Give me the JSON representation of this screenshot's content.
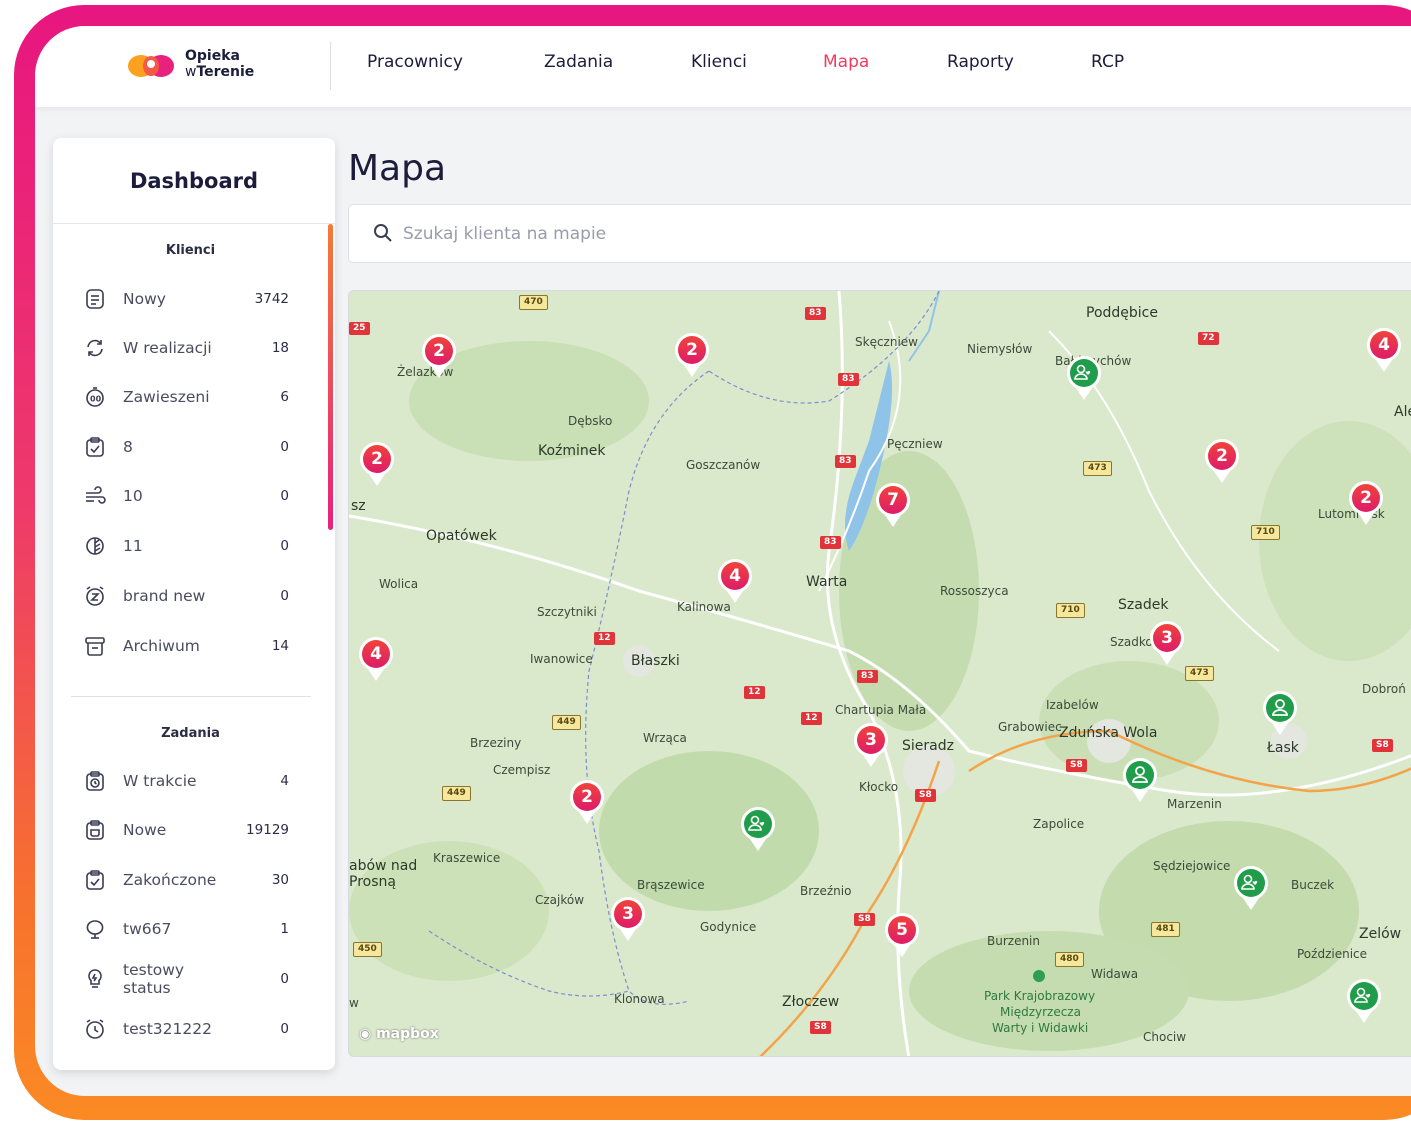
{
  "logo": {
    "line1": "Opieka",
    "line2a": "w",
    "line2b": "Terenie"
  },
  "nav": [
    {
      "label": "Pracownicy",
      "active": false
    },
    {
      "label": "Zadania",
      "active": false
    },
    {
      "label": "Klienci",
      "active": false
    },
    {
      "label": "Mapa",
      "active": true
    },
    {
      "label": "Raporty",
      "active": false
    },
    {
      "label": "RCP",
      "active": false
    }
  ],
  "sidebar": {
    "title": "Dashboard",
    "clients_section": "Klienci",
    "clients": [
      {
        "label": "Nowy",
        "count": "3742",
        "icon": "document-icon"
      },
      {
        "label": "W realizacji",
        "count": "18",
        "icon": "refresh-icon"
      },
      {
        "label": "Zawieszeni",
        "count": "6",
        "icon": "pause-timer-icon"
      },
      {
        "label": "8",
        "count": "0",
        "icon": "clipboard-check-icon"
      },
      {
        "label": "10",
        "count": "0",
        "icon": "wind-icon"
      },
      {
        "label": "11",
        "count": "0",
        "icon": "leaf-icon"
      },
      {
        "label": "brand new",
        "count": "0",
        "icon": "alarm-z-icon"
      },
      {
        "label": "Archiwum",
        "count": "14",
        "icon": "archive-icon"
      }
    ],
    "tasks_section": "Zadania",
    "tasks": [
      {
        "label": "W trakcie",
        "count": "4",
        "icon": "clipboard-clock-icon"
      },
      {
        "label": "Nowe",
        "count": "19129",
        "icon": "clipboard-new-icon"
      },
      {
        "label": "Zakończone",
        "count": "30",
        "icon": "clipboard-done-icon"
      },
      {
        "label": "tw667",
        "count": "1",
        "icon": "tree-icon"
      },
      {
        "label": "testowy status",
        "count": "0",
        "icon": "bulb-icon"
      },
      {
        "label": "test321222",
        "count": "0",
        "icon": "alarm-clock-icon"
      }
    ]
  },
  "main": {
    "title": "Mapa",
    "search_placeholder": "Szukaj klienta na mapie"
  },
  "map": {
    "attribution": "mapbox",
    "places": [
      "Poddębice",
      "Skęczniew",
      "Niemysłów",
      "Bałdrzychów",
      "Żelazków",
      "Dębsko",
      "Koźminek",
      "Goszczanów",
      "Pęczniew",
      "Opatówek",
      "Wolica",
      "Szczytniki",
      "Kalinowa",
      "Warta",
      "Rossoszyca",
      "Szadek",
      "Szadkowice",
      "Iwanowice",
      "Błaszki",
      "Chartupia Mała",
      "Izabelów",
      "Grabowiec",
      "Zduńska Wola",
      "Łask",
      "Dobroń",
      "Brzeziny",
      "Wrząca",
      "Sieradz",
      "Czempisz",
      "Kłocko",
      "Marzenin",
      "Zapolice",
      "Kraszewice",
      "Sędziejowice",
      "Buczek",
      "Czajków",
      "Brąszewice",
      "Brzeźnio",
      "Godynice",
      "Zelów",
      "Poździenice",
      "Burzenin",
      "Widawa",
      "Klonowa",
      "Złoczew",
      "Park Krajobrazowy",
      "Międzyrzecza",
      "Warty i Widawki",
      "Chociw",
      "Lutomiersk",
      "Aleksandrów",
      "abów nad",
      "Prosną",
      "sz",
      "w"
    ],
    "roads": [
      "470",
      "83",
      "72",
      "25",
      "473",
      "710",
      "12",
      "449",
      "S8",
      "450",
      "481",
      "480"
    ],
    "clusters": [
      "2",
      "2",
      "4",
      "2",
      "2",
      "7",
      "2",
      "4",
      "3",
      "4",
      "3",
      "2",
      "3",
      "5"
    ],
    "colors": {
      "cluster": "#e8304f",
      "client": "#1f9d4a"
    }
  }
}
